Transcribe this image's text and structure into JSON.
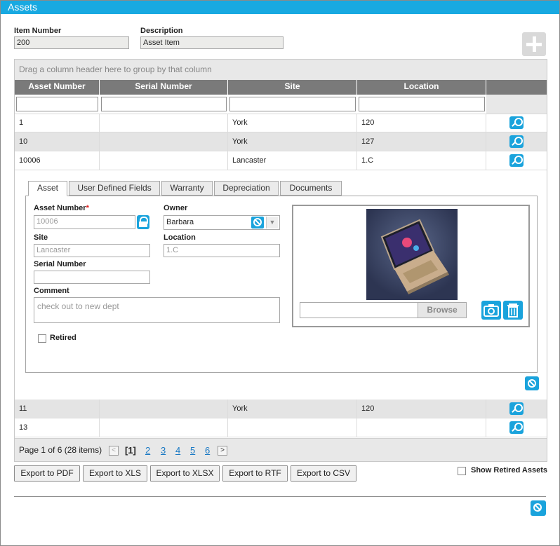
{
  "window": {
    "title": "Assets"
  },
  "header_form": {
    "item_number_label": "Item Number",
    "item_number_value": "200",
    "description_label": "Description",
    "description_value": "Asset Item"
  },
  "grid": {
    "group_panel_text": "Drag a column header here to group by that column",
    "columns": [
      "Asset Number",
      "Serial Number",
      "Site",
      "Location"
    ],
    "rows_top": [
      {
        "asset_number": "1",
        "serial_number": "",
        "site": "York",
        "location": "120"
      },
      {
        "asset_number": "10",
        "serial_number": "",
        "site": "York",
        "location": "127"
      },
      {
        "asset_number": "10006",
        "serial_number": "",
        "site": "Lancaster",
        "location": "1.C"
      }
    ],
    "rows_bottom": [
      {
        "asset_number": "11",
        "serial_number": "",
        "site": "York",
        "location": "120"
      },
      {
        "asset_number": "13",
        "serial_number": "",
        "site": "",
        "location": ""
      }
    ]
  },
  "detail": {
    "tabs": [
      "Asset",
      "User Defined Fields",
      "Warranty",
      "Depreciation",
      "Documents"
    ],
    "active_tab": "Asset",
    "asset_number_label": "Asset Number",
    "required_mark": "*",
    "asset_number_value": "10006",
    "owner_label": "Owner",
    "owner_value": "Barbara",
    "site_label": "Site",
    "site_value": "Lancaster",
    "location_label": "Location",
    "location_value": "1.C",
    "serial_label": "Serial Number",
    "serial_value": "",
    "comment_label": "Comment",
    "comment_value": "check out to new dept",
    "retired_label": "Retired",
    "retired_checked": false,
    "browse_label": "Browse"
  },
  "pager": {
    "summary": "Page 1 of 6 (28 items)",
    "prev": "<",
    "current": "[1]",
    "pages": [
      "2",
      "3",
      "4",
      "5",
      "6"
    ],
    "next": ">"
  },
  "exports": [
    "Export to PDF",
    "Export to XLS",
    "Export to XLSX",
    "Export to RTF",
    "Export to CSV"
  ],
  "show_retired_label": "Show Retired Assets",
  "show_retired_checked": false,
  "icons": {
    "add": "plus-icon",
    "view": "magnifier-icon",
    "lock": "lock-icon",
    "clear": "cancel-icon",
    "camera": "camera-icon",
    "delete": "trash-icon"
  },
  "colors": {
    "accent": "#18a9e1",
    "button": "#1aa3dc",
    "header": "#7a7a7a"
  }
}
